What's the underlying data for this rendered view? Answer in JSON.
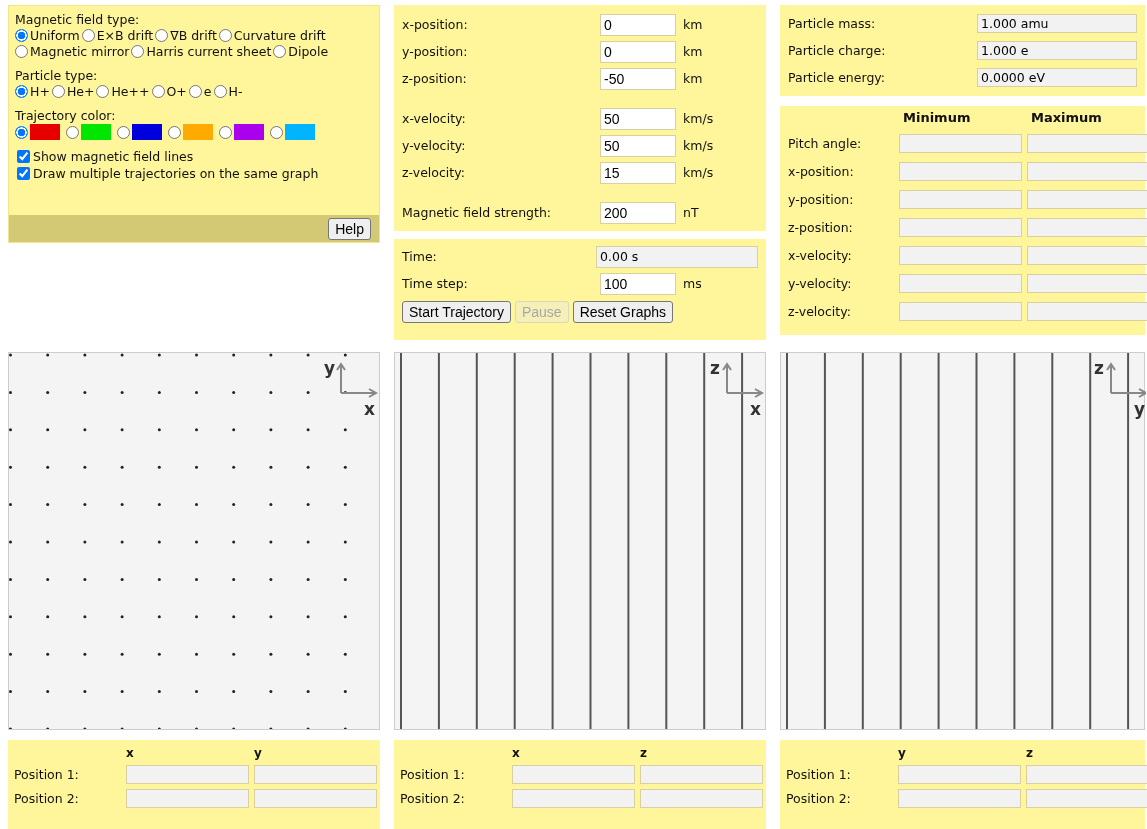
{
  "field_type": {
    "label": "Magnetic field type:",
    "options": [
      {
        "label": "Uniform",
        "selected": true
      },
      {
        "label": "E×B drift",
        "selected": false
      },
      {
        "label": "∇B drift",
        "selected": false
      },
      {
        "label": "Curvature drift",
        "selected": false
      },
      {
        "label": "Magnetic mirror",
        "selected": false
      },
      {
        "label": "Harris current sheet",
        "selected": false
      },
      {
        "label": "Dipole",
        "selected": false
      }
    ]
  },
  "particle_type": {
    "label": "Particle type:",
    "options": [
      {
        "label": "H+",
        "selected": true
      },
      {
        "label": "He+",
        "selected": false
      },
      {
        "label": "He++",
        "selected": false
      },
      {
        "label": "O+",
        "selected": false
      },
      {
        "label": "e",
        "selected": false
      },
      {
        "label": "H-",
        "selected": false
      }
    ]
  },
  "trajectory_color": {
    "label": "Trajectory color:",
    "options": [
      {
        "color": "#e60000",
        "selected": true
      },
      {
        "color": "#00e600",
        "selected": false
      },
      {
        "color": "#0000dd",
        "selected": false
      },
      {
        "color": "#ffaa00",
        "selected": false
      },
      {
        "color": "#aa00ee",
        "selected": false
      },
      {
        "color": "#00b4ff",
        "selected": false
      }
    ]
  },
  "checkboxes": [
    {
      "label": "Show magnetic field lines",
      "checked": true
    },
    {
      "label": "Draw multiple trajectories on the same graph",
      "checked": true
    }
  ],
  "help_button": "Help",
  "initial_conditions": [
    [
      {
        "label": "x-position:",
        "value": "0",
        "unit": "km"
      },
      {
        "label": "y-position:",
        "value": "0",
        "unit": "km"
      },
      {
        "label": "z-position:",
        "value": "-50",
        "unit": "km"
      }
    ],
    [
      {
        "label": "x-velocity:",
        "value": "50",
        "unit": "km/s"
      },
      {
        "label": "y-velocity:",
        "value": "50",
        "unit": "km/s"
      },
      {
        "label": "z-velocity:",
        "value": "15",
        "unit": "km/s"
      }
    ],
    [
      {
        "label": "Magnetic field strength:",
        "value": "200",
        "unit": "nT"
      }
    ]
  ],
  "time_panel": {
    "rows": [
      {
        "kind": "readout",
        "label": "Time:",
        "value": "0.00 s"
      },
      {
        "kind": "input",
        "label": "Time step:",
        "value": "100",
        "unit": "ms"
      }
    ],
    "buttons": [
      {
        "label": "Start Trajectory",
        "disabled": false
      },
      {
        "label": "Pause",
        "disabled": true
      },
      {
        "label": "Reset Graphs",
        "disabled": false
      }
    ]
  },
  "particle_info": [
    {
      "label": "Particle mass:",
      "value": "1.000 amu"
    },
    {
      "label": "Particle charge:",
      "value": "1.000 e"
    },
    {
      "label": "Particle energy:",
      "value": "0.0000 eV"
    }
  ],
  "ranges": {
    "columns": [
      "Minimum",
      "Maximum"
    ],
    "rows": [
      "Pitch angle:",
      "x-position:",
      "y-position:",
      "z-position:",
      "x-velocity:",
      "y-velocity:",
      "z-velocity:"
    ]
  },
  "graphs": [
    {
      "kind": "dots",
      "vertical_axis": "y",
      "horizontal_axis": "x",
      "positions": {
        "columns": [
          "x",
          "y"
        ],
        "rows": [
          "Position 1:",
          "Position 2:"
        ]
      }
    },
    {
      "kind": "lines",
      "vertical_axis": "z",
      "horizontal_axis": "x",
      "positions": {
        "columns": [
          "x",
          "z"
        ],
        "rows": [
          "Position 1:",
          "Position 2:"
        ]
      }
    },
    {
      "kind": "lines",
      "vertical_axis": "z",
      "horizontal_axis": "y",
      "positions": {
        "columns": [
          "y",
          "z"
        ],
        "rows": [
          "Position 1:",
          "Position 2:"
        ]
      }
    }
  ]
}
